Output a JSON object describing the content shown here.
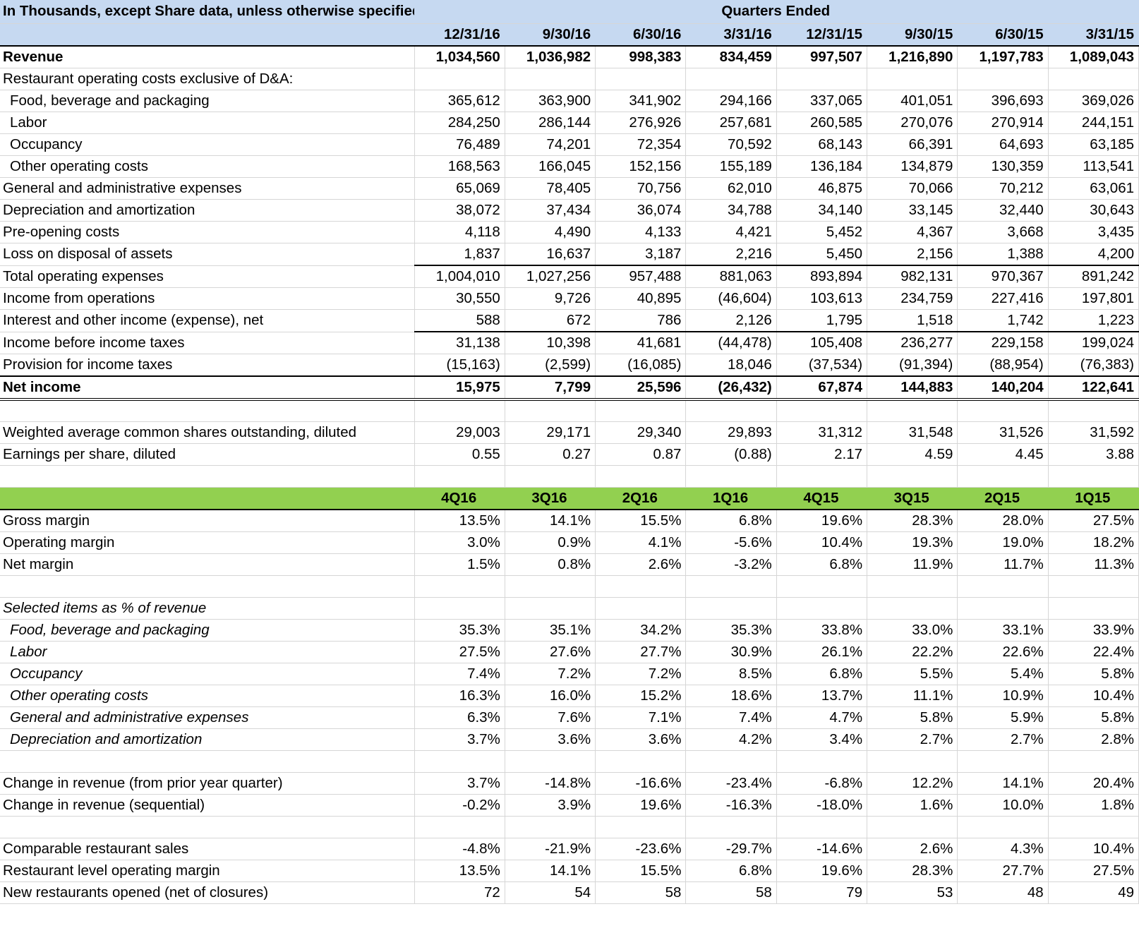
{
  "header": {
    "corner": "In Thousands, except Share data, unless otherwise specified",
    "group": "Quarters Ended",
    "dates": [
      "12/31/16",
      "9/30/16",
      "6/30/16",
      "3/31/16",
      "12/31/15",
      "9/30/15",
      "6/30/15",
      "3/31/15"
    ]
  },
  "income": [
    {
      "label": "Revenue",
      "values": [
        "1,034,560",
        "1,036,982",
        "998,383",
        "834,459",
        "997,507",
        "1,216,890",
        "1,197,783",
        "1,089,043"
      ]
    },
    {
      "label": "Restaurant operating costs exclusive of D&A:",
      "values": []
    },
    {
      "label": "Food, beverage and packaging",
      "values": [
        "365,612",
        "363,900",
        "341,902",
        "294,166",
        "337,065",
        "401,051",
        "396,693",
        "369,026"
      ]
    },
    {
      "label": "Labor",
      "values": [
        "284,250",
        "286,144",
        "276,926",
        "257,681",
        "260,585",
        "270,076",
        "270,914",
        "244,151"
      ]
    },
    {
      "label": "Occupancy",
      "values": [
        "76,489",
        "74,201",
        "72,354",
        "70,592",
        "68,143",
        "66,391",
        "64,693",
        "63,185"
      ]
    },
    {
      "label": "Other operating costs",
      "values": [
        "168,563",
        "166,045",
        "152,156",
        "155,189",
        "136,184",
        "134,879",
        "130,359",
        "113,541"
      ]
    },
    {
      "label": "General and administrative expenses",
      "values": [
        "65,069",
        "78,405",
        "70,756",
        "62,010",
        "46,875",
        "70,066",
        "70,212",
        "63,061"
      ]
    },
    {
      "label": "Depreciation and amortization",
      "values": [
        "38,072",
        "37,434",
        "36,074",
        "34,788",
        "34,140",
        "33,145",
        "32,440",
        "30,643"
      ]
    },
    {
      "label": "Pre-opening costs",
      "values": [
        "4,118",
        "4,490",
        "4,133",
        "4,421",
        "5,452",
        "4,367",
        "3,668",
        "3,435"
      ]
    },
    {
      "label": "Loss on disposal of assets",
      "values": [
        "1,837",
        "16,637",
        "3,187",
        "2,216",
        "5,450",
        "2,156",
        "1,388",
        "4,200"
      ]
    },
    {
      "label": "Total operating expenses",
      "values": [
        "1,004,010",
        "1,027,256",
        "957,488",
        "881,063",
        "893,894",
        "982,131",
        "970,367",
        "891,242"
      ]
    },
    {
      "label": "Income from operations",
      "values": [
        "30,550",
        "9,726",
        "40,895",
        "(46,604)",
        "103,613",
        "234,759",
        "227,416",
        "197,801"
      ]
    },
    {
      "label": "Interest and other income (expense), net",
      "values": [
        "588",
        "672",
        "786",
        "2,126",
        "1,795",
        "1,518",
        "1,742",
        "1,223"
      ]
    },
    {
      "label": "Income before income taxes",
      "values": [
        "31,138",
        "10,398",
        "41,681",
        "(44,478)",
        "105,408",
        "236,277",
        "229,158",
        "199,024"
      ]
    },
    {
      "label": "Provision for income taxes",
      "values": [
        "(15,163)",
        "(2,599)",
        "(16,085)",
        "18,046",
        "(37,534)",
        "(91,394)",
        "(88,954)",
        "(76,383)"
      ]
    },
    {
      "label": "Net income",
      "values": [
        "15,975",
        "7,799",
        "25,596",
        "(26,432)",
        "67,874",
        "144,883",
        "140,204",
        "122,641"
      ]
    }
  ],
  "shares": [
    {
      "label": "Weighted average common shares outstanding, diluted",
      "values": [
        "29,003",
        "29,171",
        "29,340",
        "29,893",
        "31,312",
        "31,548",
        "31,526",
        "31,592"
      ]
    },
    {
      "label": "Earnings per share, diluted",
      "values": [
        "0.55",
        "0.27",
        "0.87",
        "(0.88)",
        "2.17",
        "4.59",
        "4.45",
        "3.88"
      ]
    }
  ],
  "quarters": [
    "4Q16",
    "3Q16",
    "2Q16",
    "1Q16",
    "4Q15",
    "3Q15",
    "2Q15",
    "1Q15"
  ],
  "margins": [
    {
      "label": "Gross margin",
      "values": [
        "13.5%",
        "14.1%",
        "15.5%",
        "6.8%",
        "19.6%",
        "28.3%",
        "28.0%",
        "27.5%"
      ]
    },
    {
      "label": "Operating margin",
      "values": [
        "3.0%",
        "0.9%",
        "4.1%",
        "-5.6%",
        "10.4%",
        "19.3%",
        "19.0%",
        "18.2%"
      ]
    },
    {
      "label": "Net margin",
      "values": [
        "1.5%",
        "0.8%",
        "2.6%",
        "-3.2%",
        "6.8%",
        "11.9%",
        "11.7%",
        "11.3%"
      ]
    }
  ],
  "pct_title": "Selected items as % of revenue",
  "pct": [
    {
      "label": "Food, beverage and packaging",
      "values": [
        "35.3%",
        "35.1%",
        "34.2%",
        "35.3%",
        "33.8%",
        "33.0%",
        "33.1%",
        "33.9%"
      ]
    },
    {
      "label": "Labor",
      "values": [
        "27.5%",
        "27.6%",
        "27.7%",
        "30.9%",
        "26.1%",
        "22.2%",
        "22.6%",
        "22.4%"
      ]
    },
    {
      "label": "Occupancy",
      "values": [
        "7.4%",
        "7.2%",
        "7.2%",
        "8.5%",
        "6.8%",
        "5.5%",
        "5.4%",
        "5.8%"
      ]
    },
    {
      "label": "Other operating costs",
      "values": [
        "16.3%",
        "16.0%",
        "15.2%",
        "18.6%",
        "13.7%",
        "11.1%",
        "10.9%",
        "10.4%"
      ]
    },
    {
      "label": "General and administrative expenses",
      "values": [
        "6.3%",
        "7.6%",
        "7.1%",
        "7.4%",
        "4.7%",
        "5.8%",
        "5.9%",
        "5.8%"
      ]
    },
    {
      "label": "Depreciation and amortization",
      "values": [
        "3.7%",
        "3.6%",
        "3.6%",
        "4.2%",
        "3.4%",
        "2.7%",
        "2.7%",
        "2.8%"
      ]
    }
  ],
  "changes": [
    {
      "label": "Change in revenue (from prior year quarter)",
      "values": [
        "3.7%",
        "-14.8%",
        "-16.6%",
        "-23.4%",
        "-6.8%",
        "12.2%",
        "14.1%",
        "20.4%"
      ]
    },
    {
      "label": "Change in revenue (sequential)",
      "values": [
        "-0.2%",
        "3.9%",
        "19.6%",
        "-16.3%",
        "-18.0%",
        "1.6%",
        "10.0%",
        "1.8%"
      ]
    }
  ],
  "ops": [
    {
      "label": "Comparable restaurant sales",
      "values": [
        "-4.8%",
        "-21.9%",
        "-23.6%",
        "-29.7%",
        "-14.6%",
        "2.6%",
        "4.3%",
        "10.4%"
      ]
    },
    {
      "label": "Restaurant level operating margin",
      "values": [
        "13.5%",
        "14.1%",
        "15.5%",
        "6.8%",
        "19.6%",
        "28.3%",
        "27.7%",
        "27.5%"
      ]
    },
    {
      "label": "New restaurants opened (net of closures)",
      "values": [
        "72",
        "54",
        "58",
        "58",
        "79",
        "53",
        "48",
        "49"
      ]
    }
  ]
}
